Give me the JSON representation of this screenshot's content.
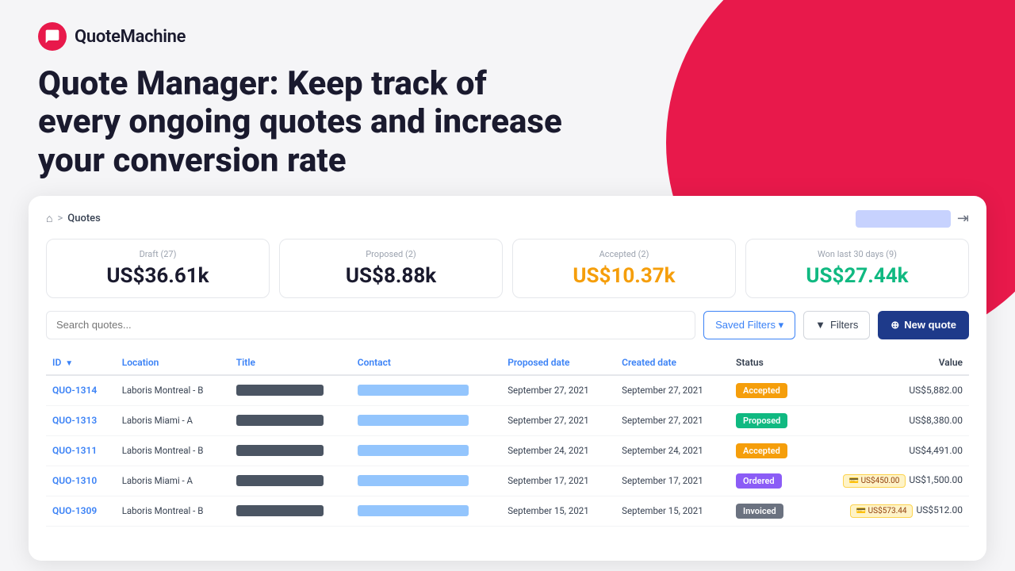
{
  "logo": {
    "text": "QuoteMachine"
  },
  "headline": "Quote Manager: Keep track of every ongoing quotes and increase your conversion rate",
  "breadcrumb": {
    "home_icon": "⌂",
    "separator": ">",
    "current": "Quotes"
  },
  "stats": [
    {
      "label": "Draft  (27)",
      "value": "US$36.61k",
      "color": "default"
    },
    {
      "label": "Proposed  (2)",
      "value": "US$8.88k",
      "color": "default"
    },
    {
      "label": "Accepted  (2)",
      "value": "US$10.37k",
      "color": "orange"
    },
    {
      "label": "Won last 30 days  (9)",
      "value": "US$27.44k",
      "color": "green"
    }
  ],
  "toolbar": {
    "search_placeholder": "Search quotes...",
    "saved_filters_label": "Saved Filters ▾",
    "filters_label": "Filters",
    "new_quote_label": "New quote"
  },
  "table": {
    "columns": [
      "ID",
      "Location",
      "Title",
      "Contact",
      "Proposed date",
      "Created date",
      "Status",
      "Value"
    ],
    "rows": [
      {
        "id": "QUO-1314",
        "location": "Laboris Montreal - B",
        "proposed_date": "September 27, 2021",
        "created_date": "September 27, 2021",
        "status": "Accepted",
        "status_class": "accepted",
        "value": "US$5,882.00",
        "invoice_badge": null
      },
      {
        "id": "QUO-1313",
        "location": "Laboris Miami - A",
        "proposed_date": "September 27, 2021",
        "created_date": "September 27, 2021",
        "status": "Proposed",
        "status_class": "proposed",
        "value": "US$8,380.00",
        "invoice_badge": null
      },
      {
        "id": "QUO-1311",
        "location": "Laboris Montreal - B",
        "proposed_date": "September 24, 2021",
        "created_date": "September 24, 2021",
        "status": "Accepted",
        "status_class": "accepted",
        "value": "US$4,491.00",
        "invoice_badge": null
      },
      {
        "id": "QUO-1310",
        "location": "Laboris Miami - A",
        "proposed_date": "September 17, 2021",
        "created_date": "September 17, 2021",
        "status": "Ordered",
        "status_class": "ordered",
        "value": "US$1,500.00",
        "invoice_badge": "US$450.00"
      },
      {
        "id": "QUO-1309",
        "location": "Laboris Montreal - B",
        "proposed_date": "September 15, 2021",
        "created_date": "September 15, 2021",
        "status": "Invoiced",
        "status_class": "invoiced",
        "value": "US$512.00",
        "invoice_badge": "US$573.44"
      }
    ]
  }
}
